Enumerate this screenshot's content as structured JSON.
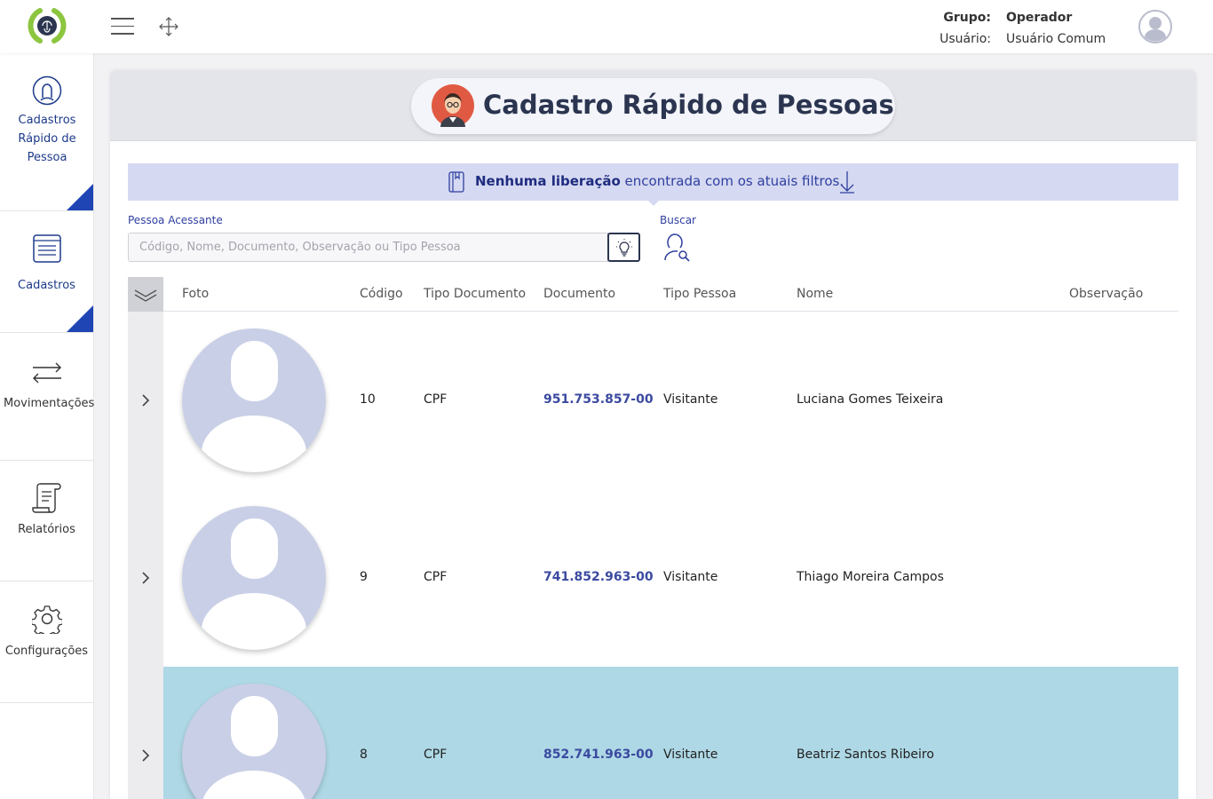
{
  "header": {
    "grupo_label": "Grupo:",
    "grupo_value": "Operador",
    "usuario_label": "Usuário:",
    "usuario_value": "Usuário Comum"
  },
  "sidebar": {
    "items": [
      {
        "label": "Cadastros Rápido de Pessoa",
        "icon": "user-circle-icon",
        "active": true
      },
      {
        "label": "Cadastros",
        "icon": "form-list-icon",
        "active": true
      },
      {
        "label": "Movimentações",
        "icon": "transfer-arrows-icon",
        "active": false
      },
      {
        "label": "Relatórios",
        "icon": "report-scroll-icon",
        "active": false
      },
      {
        "label": "Configurações",
        "icon": "gear-icon",
        "active": false
      }
    ]
  },
  "page": {
    "title": "Cadastro Rápido de Pessoas"
  },
  "banner": {
    "bold": "Nenhuma liberação",
    "rest": " encontrada com os atuais filtros."
  },
  "filters": {
    "pessoa_label": "Pessoa Acessante",
    "pessoa_placeholder": "Código, Nome, Documento, Observação ou Tipo Pessoa",
    "buscar_label": "Buscar"
  },
  "table": {
    "columns": [
      "Foto",
      "Código",
      "Tipo Documento",
      "Documento",
      "Tipo Pessoa",
      "Nome",
      "Observação"
    ],
    "rows": [
      {
        "codigo": "10",
        "tipo_documento": "CPF",
        "documento": "951.753.857-00",
        "tipo_pessoa": "Visitante",
        "nome": "Luciana Gomes Teixeira",
        "observacao": "",
        "selected": false
      },
      {
        "codigo": "9",
        "tipo_documento": "CPF",
        "documento": "741.852.963-00",
        "tipo_pessoa": "Visitante",
        "nome": "Thiago Moreira Campos",
        "observacao": "",
        "selected": false
      },
      {
        "codigo": "8",
        "tipo_documento": "CPF",
        "documento": "852.741.963-00",
        "tipo_pessoa": "Visitante",
        "nome": "Beatriz Santos Ribeiro",
        "observacao": "",
        "selected": true
      }
    ]
  },
  "colors": {
    "accent": "#1f45b5",
    "banner_bg": "#d5d9f1",
    "selected_row": "#aed8e5",
    "logo_green": "#8cc63f"
  }
}
